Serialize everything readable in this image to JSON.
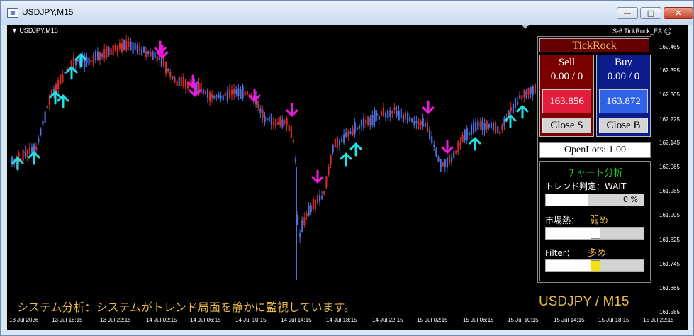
{
  "window": {
    "title": "USDJPY,M15",
    "min_label": "—",
    "max_label": "□",
    "close_label": "✕"
  },
  "chart": {
    "symbol_label": "USDJPY,M15",
    "ea_label": "S-6 TickRock_EA",
    "smiley": "☺",
    "price_labels": [
      "162.465",
      "162.395",
      "162.305",
      "162.225",
      "162.145",
      "162.065",
      "161.985",
      "161.905",
      "161.825",
      "161.745",
      "161.665",
      "161.585"
    ],
    "time_labels": [
      "13 Jul 2026",
      "13 Jul 18:15",
      "13 Jul 22:15",
      "14 Jul 02:15",
      "14 Jul 06:15",
      "14 Jul 10:15",
      "14 Jul 14:15",
      "14 Jul 18:15",
      "14 Jul 22:15",
      "15 Jul 02:15",
      "15 Jul 06:15",
      "15 Jul 10:15",
      "15 Jul 14:15",
      "15 Jul 18:15",
      "15 Jul 22:15"
    ],
    "system_message": "システム分析：システムがトレンド局面を静かに監視しています。",
    "pair_label": "USDJPY / M15",
    "colors": {
      "bull": "#4d6fd6",
      "bear": "#d42b2b",
      "up_arrow": "#1fe0e6",
      "down_arrow": "#ee18e0"
    }
  },
  "panel": {
    "title": "TickRock",
    "sell": {
      "label": "Sell",
      "lots": "0.00 / 0",
      "price": "163.856",
      "close_label": "Close S",
      "color": "#e21e3c"
    },
    "buy": {
      "label": "Buy",
      "lots": "0.00 / 0",
      "price": "163.872",
      "close_label": "Close B",
      "color": "#2f62e6"
    },
    "open_lots": "OpenLots: 1.00",
    "analysis": {
      "title": "チャート分析",
      "trend_label": "トレンド判定：WAIT",
      "trend_percent": "0 %",
      "heat_label": "市場熱：",
      "heat_value": "弱め",
      "heat_level": 0.5,
      "filter_label": "Filter：",
      "filter_value": "多め",
      "filter_level": 0.5
    }
  }
}
